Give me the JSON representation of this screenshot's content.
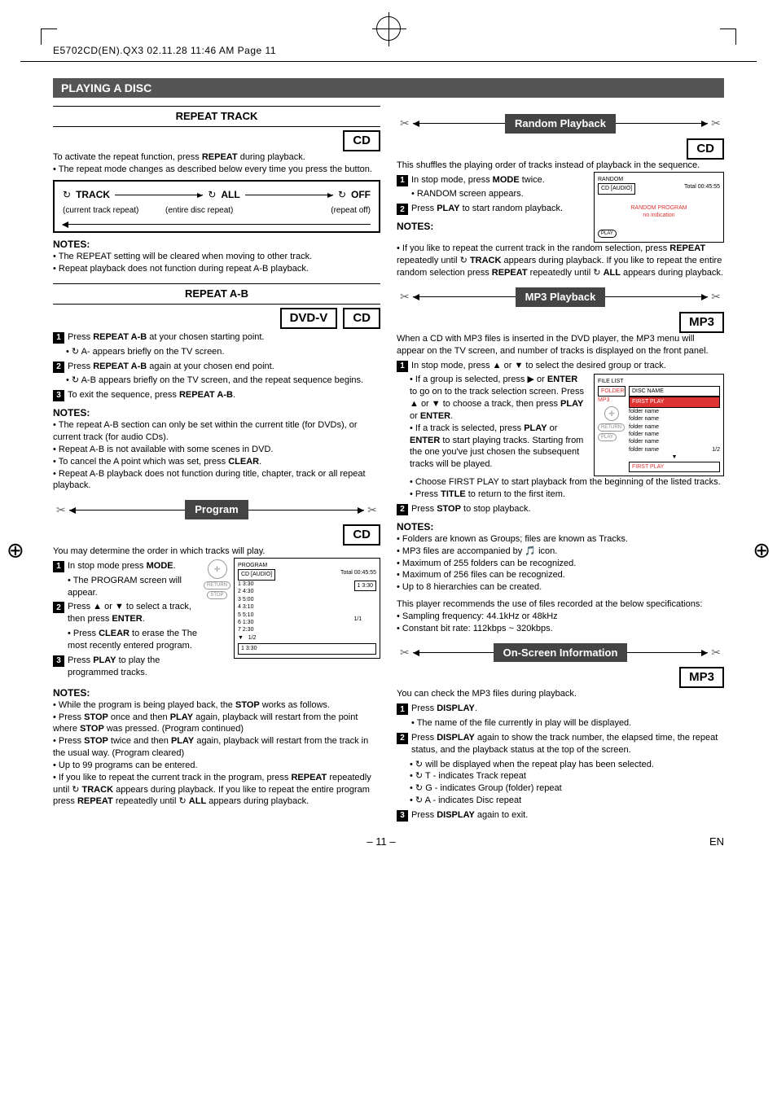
{
  "meta": {
    "header": "E5702CD(EN).QX3  02.11.28 11:46 AM  Page 11"
  },
  "section_bar": "PLAYING A DISC",
  "left": {
    "repeat_track": {
      "heading": "REPEAT TRACK",
      "badge": "CD",
      "intro": "To activate the repeat function, press REPEAT during playback.",
      "bullets": [
        "The repeat mode changes as described below every time you press the button."
      ],
      "diag": {
        "sym": "↻",
        "a": "TRACK",
        "b": "ALL",
        "c": "OFF",
        "la": "(current track repeat)",
        "lb": "(entire disc repeat)",
        "lc": "(repeat off)"
      },
      "notes_h": "NOTES:",
      "notes": [
        "The REPEAT setting will be cleared when moving to other track.",
        "Repeat playback does not function during repeat A-B playback."
      ]
    },
    "repeat_ab": {
      "heading": "REPEAT A-B",
      "badges": [
        "DVD-V",
        "CD"
      ],
      "steps": [
        {
          "n": "1",
          "t": "Press REPEAT A-B at your chosen starting point."
        },
        {
          "n": "2",
          "t": "Press REPEAT A-B again at your chosen end point."
        },
        {
          "n": "3",
          "t": "To exit the sequence, press REPEAT A-B."
        }
      ],
      "sub1": "↻ A- appears briefly on the TV screen.",
      "sub2": "↻ A-B appears briefly on the TV screen, and the repeat sequence begins.",
      "notes_h": "NOTES:",
      "notes": [
        "The repeat A-B section can only be set within the current title (for DVDs), or current track (for audio CDs).",
        "Repeat A-B is not available with some scenes in DVD.",
        "To cancel the A point which was set, press CLEAR.",
        "Repeat A-B playback does not function during title, chapter, track or all repeat playback."
      ]
    },
    "program": {
      "ribbon": "Program",
      "badge": "CD",
      "intro": "You may determine the order in which tracks will play.",
      "steps": [
        {
          "n": "1",
          "t": "In stop mode press MODE."
        },
        {
          "n": "2",
          "t": "Press ▲ or ▼ to select a track, then press ENTER."
        },
        {
          "n": "3",
          "t": "Press PLAY to play the programmed tracks."
        }
      ],
      "sub1": "• The PROGRAM screen will appear.",
      "sub2": "• Press CLEAR to erase the The most recently entered program.",
      "screen": {
        "title": "PROGRAM",
        "disc": "CD [AUDIO]",
        "total": "Total 00:45:55",
        "list": [
          "1  3:30",
          "2  4:30",
          "3  5:00",
          "4  3:10",
          "5  5:10",
          "6  1:30",
          "7  2:30",
          "1  3:30"
        ],
        "sel": "1  3:30",
        "page": "1/2",
        "right": "1/1",
        "nav": [
          "RETURN",
          "STOP"
        ]
      },
      "notes_h": "NOTES:",
      "notes": [
        "While the program is being played back, the STOP works as follows.",
        "Press STOP once and then PLAY again, playback will restart from the point where STOP was pressed. (Program continued)",
        "Press STOP twice and then PLAY again, playback will restart from the track in the usual way. (Program cleared)",
        "Up to 99 programs can be entered.",
        "If you like to repeat the current track in the program, press REPEAT repeatedly until ↻ TRACK appears during playback. If you like to repeat the entire program press REPEAT repeatedly until ↻ ALL appears during playback."
      ]
    }
  },
  "right": {
    "random": {
      "ribbon": "Random Playback",
      "badge": "CD",
      "intro": "This shuffles the playing order of tracks instead of playback in the sequence.",
      "steps": [
        {
          "n": "1",
          "t": "In stop mode, press MODE twice."
        },
        {
          "n": "2",
          "t": "Press PLAY to start random playback."
        }
      ],
      "sub1": "• RANDOM screen appears.",
      "screen": {
        "title": "RANDOM",
        "disc": "CD [AUDIO]",
        "total": "Total 00:45:55",
        "msg1": "RANDOM PROGRAM",
        "msg2": "no indication",
        "nav": "PLAY"
      },
      "notes_h": "NOTES:",
      "note_p": "If you like to repeat the current track in the random selection, press REPEAT repeatedly until ↻ TRACK appears during playback. If you like to repeat the entire random selection press REPEAT repeatedly until ↻ ALL appears during playback."
    },
    "mp3": {
      "ribbon": "MP3 Playback",
      "badge": "MP3",
      "intro": "When a CD with MP3 files is inserted in the DVD player, the MP3 menu will appear on the TV screen, and number of tracks is displayed on the front panel.",
      "step1": {
        "n": "1",
        "t": "In stop mode, press ▲ or ▼ to select the desired group or track."
      },
      "sub_a": "If a group is selected, press ▶ or ENTER to go on to the track selection screen. Press ▲ or ▼ to choose a track, then press PLAY or ENTER.",
      "sub_b": "If a track is selected, press PLAY or ENTER to start playing tracks. Starting from the one you've just chosen the subsequent tracks will be played.",
      "sub_c": "Choose FIRST PLAY to start playback from the beginning of the listed tracks.",
      "sub_d": "Press TITLE to return to the first item.",
      "screen": {
        "title": "FILE LIST",
        "folder": "FOLDER",
        "mp3": "MP3",
        "disc": "DISC NAME",
        "first": "FIRST PLAY",
        "items": [
          "folder name",
          "folder name",
          "folder name",
          "folder name",
          "folder name",
          "folder name"
        ],
        "page": "1/2",
        "bottom": "FIRST PLAY",
        "nav": [
          "RETURN",
          "PLAY"
        ]
      },
      "step2": {
        "n": "2",
        "t": "Press STOP to stop playback."
      },
      "notes_h": "NOTES:",
      "notes": [
        "Folders are known as Groups; files are known as Tracks.",
        "MP3 files are accompanied by 🎵 icon.",
        "Maximum of 255 folders can be recognized.",
        "Maximum of 256 files can be recognized.",
        "Up to 8 hierarchies can be created."
      ],
      "rec_p": "This player recommends the use of files recorded at the below specifications:",
      "rec": [
        "Sampling frequency: 44.1kHz or 48kHz",
        "Constant bit rate: 112kbps ~ 320kbps."
      ]
    },
    "osd": {
      "ribbon": "On-Screen Information",
      "badge": "MP3",
      "intro": "You can check the MP3 files during playback.",
      "step1": {
        "n": "1",
        "t": "Press DISPLAY."
      },
      "sub1": "• The name of the file currently in play will be displayed.",
      "step2": {
        "n": "2",
        "t": "Press DISPLAY again to show the track number, the elapsed time, the repeat status, and the playback status at the top of the screen."
      },
      "subs2": [
        "↻ will be displayed when the repeat play has been selected.",
        "↻ T - indicates Track repeat",
        "↻ G - indicates Group (folder) repeat",
        "↻ A - indicates Disc repeat"
      ],
      "step3": {
        "n": "3",
        "t": "Press DISPLAY again to exit."
      }
    }
  },
  "footer": {
    "page": "– 11 –",
    "lang": "EN"
  }
}
